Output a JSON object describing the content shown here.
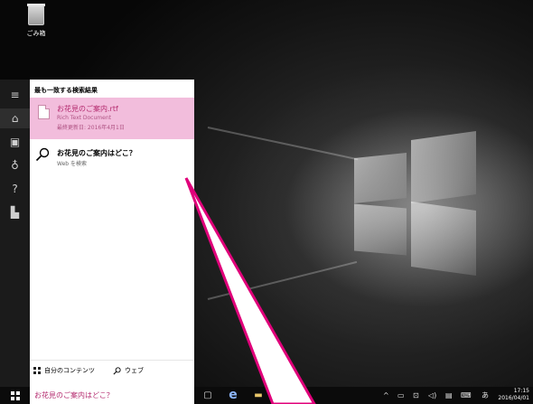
{
  "desktop": {
    "recycle_bin_label": "ごみ箱"
  },
  "search_panel": {
    "header": "最も一致する検索結果",
    "best_match": {
      "title": "お花見のご案内.rtf",
      "type": "Rich Text Document",
      "modified": "最終更新日: 2016年4月1日"
    },
    "web_result": {
      "title": "お花見のご案内はどこ？",
      "subtitle": "Web を検索"
    },
    "filters": {
      "my_content": "自分のコンテンツ",
      "web": "ウェブ"
    }
  },
  "taskbar": {
    "search_query": "お花見のご案内はどこ？",
    "ime_mode": "あ",
    "time": "17:15",
    "date": "2016/04/01"
  },
  "colors": {
    "accent_pink": "#e0007a",
    "highlight_bg": "#f2bddc",
    "highlight_text": "#b42a6e"
  }
}
